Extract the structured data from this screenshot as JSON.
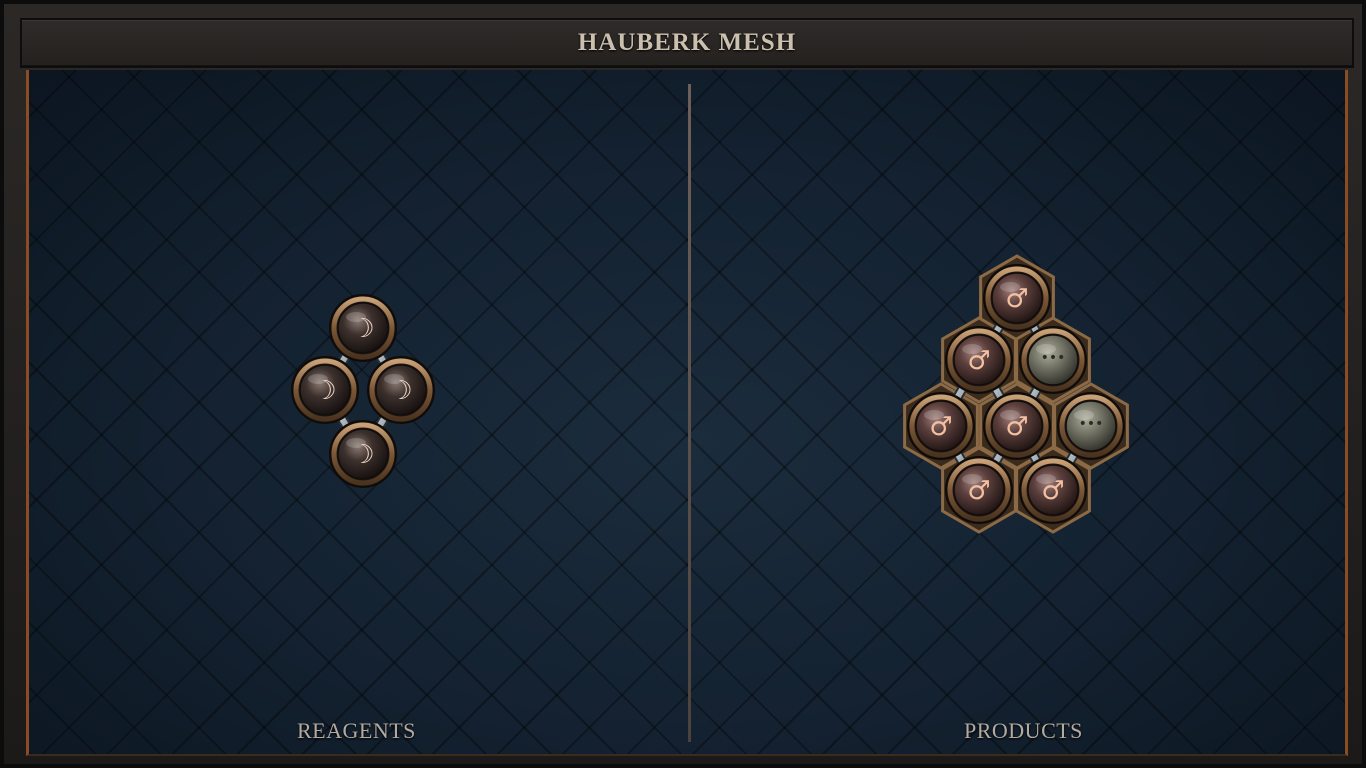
{
  "title": "HAUBERK MESH",
  "reagents": {
    "label": "REAGENTS",
    "atoms": [
      {
        "element": "salt",
        "symbol": "☽"
      },
      {
        "element": "salt",
        "symbol": "☽"
      },
      {
        "element": "salt",
        "symbol": "☽"
      },
      {
        "element": "salt",
        "symbol": "☽"
      }
    ]
  },
  "products": {
    "label": "PRODUCTS",
    "atoms": [
      {
        "element": "iron",
        "symbol": "♂"
      },
      {
        "element": "iron",
        "symbol": "♂"
      },
      {
        "element": "iron",
        "symbol": "♂"
      },
      {
        "element": "iron",
        "symbol": "♂"
      },
      {
        "element": "iron",
        "symbol": "♂"
      },
      {
        "element": "iron",
        "symbol": "♂"
      },
      {
        "element": "quintessence",
        "symbol": "•••"
      },
      {
        "element": "quintessence",
        "symbol": "•••"
      }
    ]
  },
  "colors": {
    "frame_accent": "#8a4d23",
    "salt_glyph": "#f1d6c6",
    "iron_glyph": "#f3c0a2",
    "quint_atom": "#79796a"
  }
}
